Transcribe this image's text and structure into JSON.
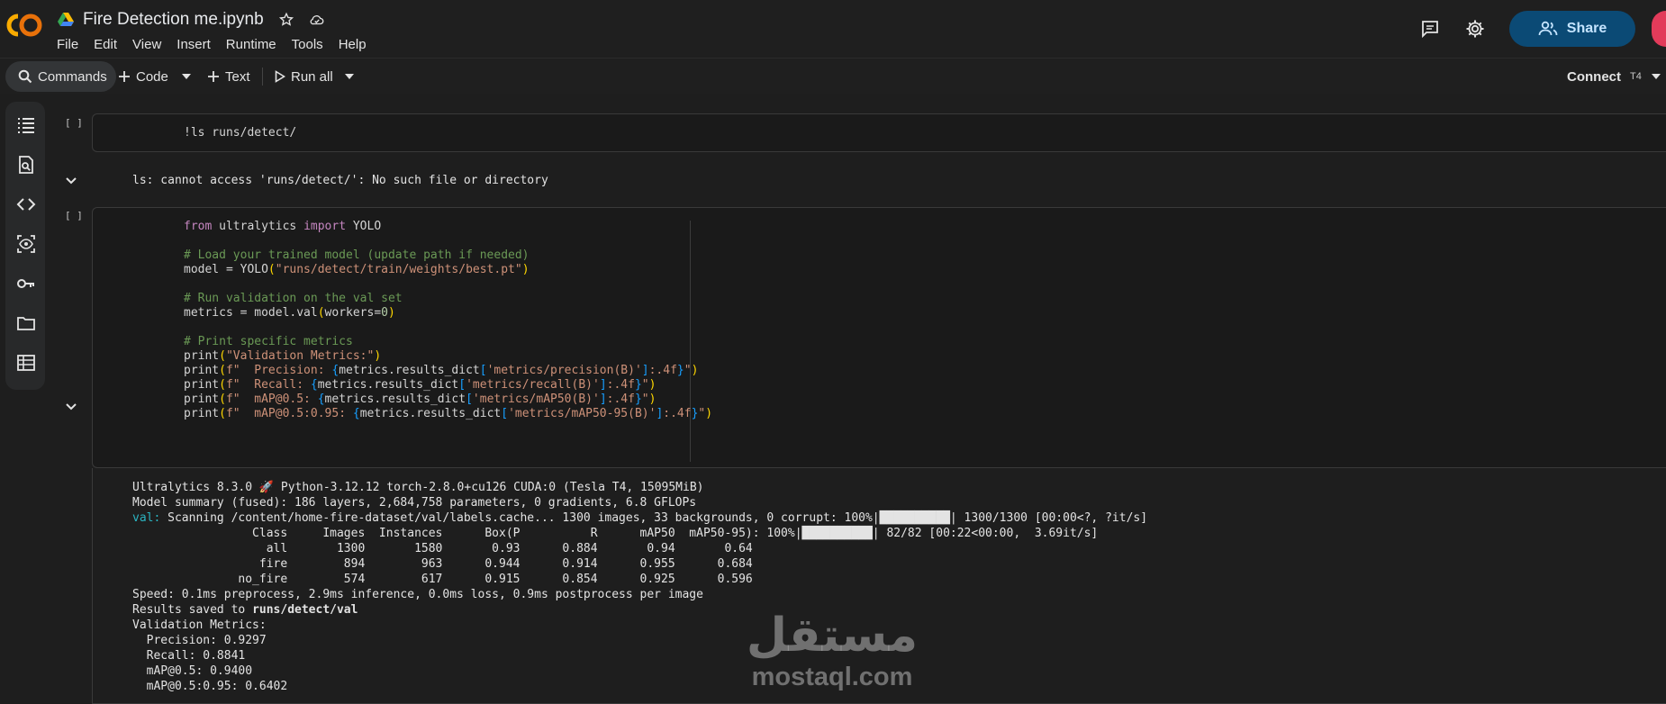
{
  "header": {
    "title": "Fire Detection me.ipynb",
    "menu": [
      "File",
      "Edit",
      "View",
      "Insert",
      "Runtime",
      "Tools",
      "Help"
    ],
    "share_label": "Share",
    "icons": [
      "colab-logo",
      "drive-icon",
      "star-icon",
      "cloud-icon",
      "comment-icon",
      "gear-icon",
      "people-icon"
    ]
  },
  "toolbar": {
    "commands": "Commands",
    "code": "Code",
    "text": "Text",
    "run_all": "Run all",
    "connect": "Connect",
    "runtime": "T4"
  },
  "cells": [
    {
      "marker": "[ ]",
      "code": [
        "!ls runs/detect/"
      ],
      "output": [
        "ls: cannot access 'runs/detect/': No such file or directory"
      ]
    },
    {
      "marker": "[ ]",
      "code": [
        "from ultralytics import YOLO",
        "",
        "# Load your trained model (update path if needed)",
        "model = YOLO(\"runs/detect/train/weights/best.pt\")",
        "",
        "# Run validation on the val set",
        "metrics = model.val(workers=0)",
        "",
        "# Print specific metrics",
        "print(\"Validation Metrics:\")",
        "print(f\"  Precision: {metrics.results_dict['metrics/precision(B)']:.4f}\")",
        "print(f\"  Recall: {metrics.results_dict['metrics/recall(B)']:.4f}\")",
        "print(f\"  mAP@0.5: {metrics.results_dict['metrics/mAP50(B)']:.4f}\")",
        "print(f\"  mAP@0.5:0.95: {metrics.results_dict['metrics/mAP50-95(B)']:.4f}\")"
      ],
      "output": {
        "line1": "Ultralytics 8.3.0 🚀 Python-3.12.12 torch-2.8.0+cu126 CUDA:0 (Tesla T4, 15095MiB)",
        "line2": "Model summary (fused): 186 layers, 2,684,758 parameters, 0 gradients, 6.8 GFLOPs",
        "val_prefix": "val:",
        "val_rest": " Scanning /content/home-fire-dataset/val/labels.cache... 1300 images, 33 backgrounds, 0 corrupt: 100%|██████████| 1300/1300 [00:00<?, ?it/s]",
        "table_header": "                 Class     Images  Instances      Box(P          R      mAP50  mAP50-95): 100%|██████████| 82/82 [00:22<00:00,  3.69it/s]",
        "rows": [
          "                   all       1300       1580       0.93      0.884       0.94       0.64",
          "                  fire        894        963      0.944      0.914      0.955      0.684",
          "               no_fire        574        617      0.915      0.854      0.925      0.596"
        ],
        "speed": "Speed: 0.1ms preprocess, 2.9ms inference, 0.0ms loss, 0.9ms postprocess per image",
        "saved_prefix": "Results saved to ",
        "saved_path": "runs/detect/val",
        "metrics": [
          "Validation Metrics:",
          "  Precision: 0.9297",
          "  Recall: 0.8841",
          "  mAP@0.5: 0.9400",
          "  mAP@0.5:0.95: 0.6402"
        ]
      }
    }
  ],
  "watermark": {
    "arabic": "مستقل",
    "latin": "mostaql.com"
  }
}
